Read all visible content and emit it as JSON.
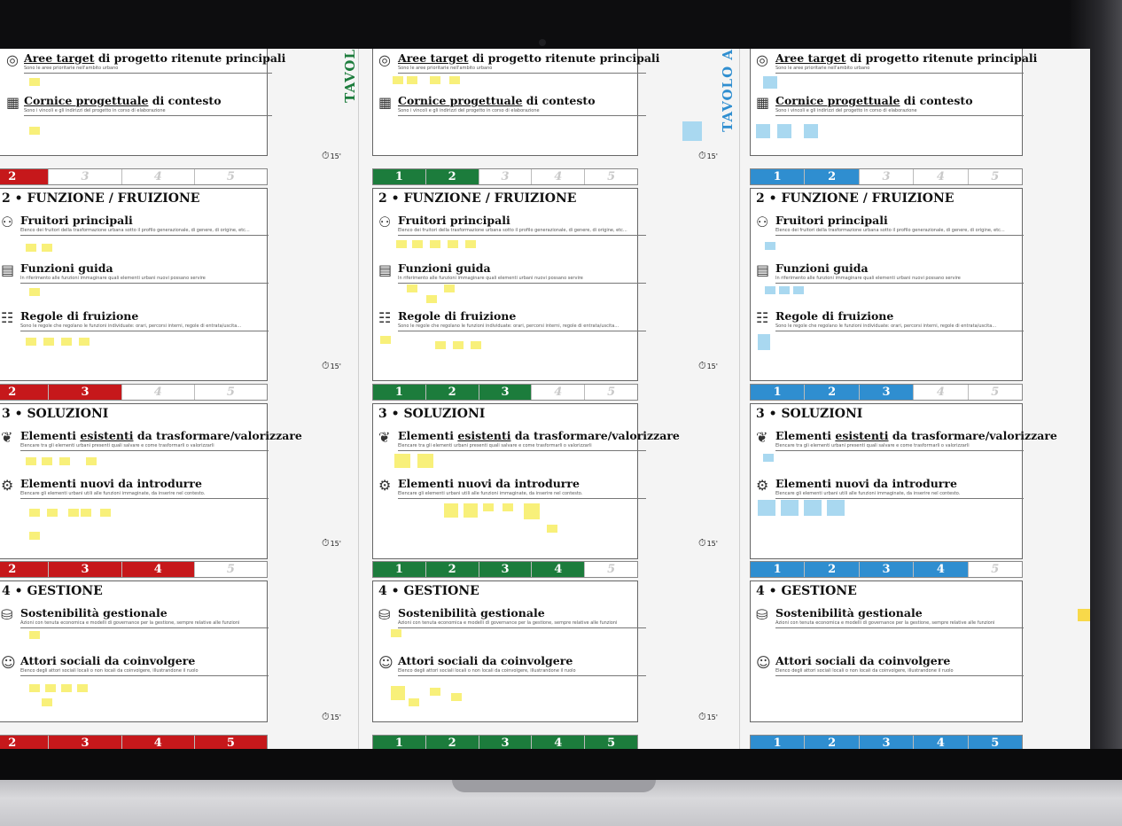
{
  "colors": {
    "red": "#c6181b",
    "green": "#1c7c3c",
    "blue": "#2f8ed0",
    "sticky_yellow": "#f8f07a",
    "sticky_blue": "#a9d8f0"
  },
  "vertical_titles": {
    "middle": "TAVOL",
    "right": "TAVOLO A"
  },
  "timer_label": "15'",
  "section1": {
    "items": [
      {
        "icon": "target-icon",
        "head_underlined": "Aree target",
        "head_rest": " di progetto ritenute principali",
        "desc": "Sono le aree prioritarie nell'ambito urbano"
      },
      {
        "icon": "building-icon",
        "head_underlined": "Cornice progettuale",
        "head_rest": " di contesto",
        "desc": "Sono i vincoli e gli indirizzi del progetto in corso di elaborazione"
      }
    ]
  },
  "section2": {
    "title": "2 • FUNZIONE / FRUIZIONE",
    "items": [
      {
        "icon": "users-icon",
        "head": "Fruitori principali",
        "desc": "Elenco dei fruitori della trasformazione urbana sotto il profilo generazionale, di genere, di origine, etc..."
      },
      {
        "icon": "functions-icon",
        "head": "Funzioni guida",
        "desc": "In riferimento alle funzioni immaginare quali elementi urbani nuovi possano servire"
      },
      {
        "icon": "rules-icon",
        "head": "Regole di fruizione",
        "desc": "Sono le regole che regolano le funzioni individuate: orari, percorsi interni, regole di entrata/uscita..."
      }
    ]
  },
  "section3": {
    "title": "3 • SOLUZIONI",
    "items": [
      {
        "icon": "plant-icon",
        "head_pre": "Elementi ",
        "head_underlined": "esistenti",
        "head_rest": " da trasformare/valorizzare",
        "desc": "Elencare tra gli elementi urbani presenti quali salvare e come trasformarli o valorizzarli"
      },
      {
        "icon": "gears-icon",
        "head": "Elementi nuovi da introdurre",
        "desc": "Elencare gli elementi urbani utili alle funzioni immaginate, da inserire nel contesto."
      }
    ]
  },
  "section4": {
    "title": "4 • GESTIONE",
    "items": [
      {
        "icon": "coins-icon",
        "head": "Sostenibilità gestionale",
        "desc": "Azioni con tenuta economica e modelli di governance per la gestione, sempre relative alle funzioni"
      },
      {
        "icon": "people-icon",
        "head": "Attori sociali da coinvolgere",
        "desc": "Elenco degli attori sociali locali o non locali da coinvolgere, illustrandone il ruolo"
      }
    ]
  },
  "progress_numbers": [
    "1",
    "2",
    "3",
    "4",
    "5"
  ]
}
